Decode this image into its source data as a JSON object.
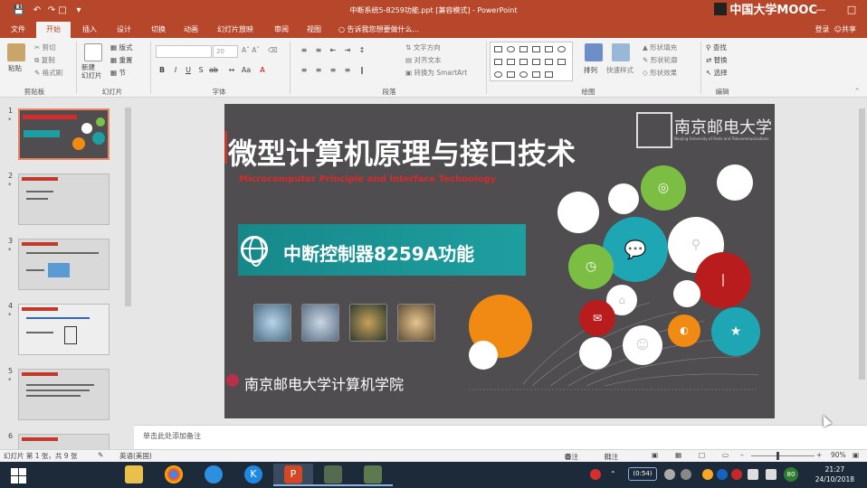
{
  "window": {
    "doc_title": "中断系统5-8259功能.ppt [兼容模式] - PowerPoint",
    "brand_overlay": "中国大学MOOC",
    "controls": [
      "—",
      "□",
      "✕"
    ]
  },
  "quick_access": [
    "save-icon",
    "undo-icon",
    "redo-icon",
    "present-icon",
    "customize-icon"
  ],
  "tabs": [
    {
      "label": "文件",
      "active": false
    },
    {
      "label": "开始",
      "active": true
    },
    {
      "label": "插入",
      "active": false
    },
    {
      "label": "设计",
      "active": false
    },
    {
      "label": "切换",
      "active": false
    },
    {
      "label": "动画",
      "active": false
    },
    {
      "label": "幻灯片放映",
      "active": false
    },
    {
      "label": "审阅",
      "active": false
    },
    {
      "label": "视图",
      "active": false
    }
  ],
  "tellme": "告诉我您想要做什么...",
  "share": "共享",
  "user_label": "登录",
  "ribbon": {
    "clipboard": {
      "label": "剪贴板",
      "paste": "粘贴",
      "cut": "剪切",
      "copy": "复制",
      "format_painter": "格式刷"
    },
    "slides": {
      "label": "幻灯片",
      "new_slide": "新建\n幻灯片",
      "layout": "版式",
      "reset": "重置",
      "section": "节"
    },
    "font": {
      "label": "字体",
      "font_name": "",
      "font_size": "20"
    },
    "paragraph": {
      "label": "段落",
      "text_direction": "文字方向",
      "align_text": "对齐文本",
      "smartart": "转换为 SmartArt"
    },
    "drawing": {
      "label": "绘图",
      "arrange": "排列",
      "quick_styles": "快速样式",
      "shape_fill": "形状填充",
      "shape_outline": "形状轮廓",
      "shape_effects": "形状效果"
    },
    "editing": {
      "label": "编辑",
      "find": "查找",
      "replace": "替换",
      "select": "选择"
    }
  },
  "thumbnails": [
    {
      "num": "1",
      "selected": true
    },
    {
      "num": "2",
      "selected": false
    },
    {
      "num": "3",
      "selected": false
    },
    {
      "num": "4",
      "selected": false
    },
    {
      "num": "5",
      "selected": false
    },
    {
      "num": "6",
      "selected": false
    }
  ],
  "slide": {
    "title": "微型计算机原理与接口技术",
    "subtitle": "Microcomputer Principle and Interface Technology",
    "topic": "中断控制器8259A功能",
    "university_name": "南京邮电大学",
    "university_en": "Nanjing University of Posts and Telecommunications",
    "school": "南京邮电大学计算机学院"
  },
  "notes_placeholder": "单击此处添加备注",
  "status": {
    "slide_info": "幻灯片 第 1 张，共 9 张",
    "language": "英语(美国)",
    "notes_btn": "备注",
    "comments_btn": "批注",
    "zoom": "90%"
  },
  "taskbar": {
    "apps": [
      "file-explorer-icon",
      "chrome-icon",
      "edge-icon",
      "k-app-icon",
      "powerpoint-icon",
      "slide-app-icon",
      "slide-app-icon-2"
    ],
    "net_time": "(0:54)",
    "tray_badge": "80",
    "time": "21:27",
    "date": "24/10/2018"
  },
  "colors": {
    "accent": "#b7472a",
    "slide_bg": "#4f4d4f",
    "topic_band": "#1e9ea0",
    "title_red": "#d62b2b"
  }
}
